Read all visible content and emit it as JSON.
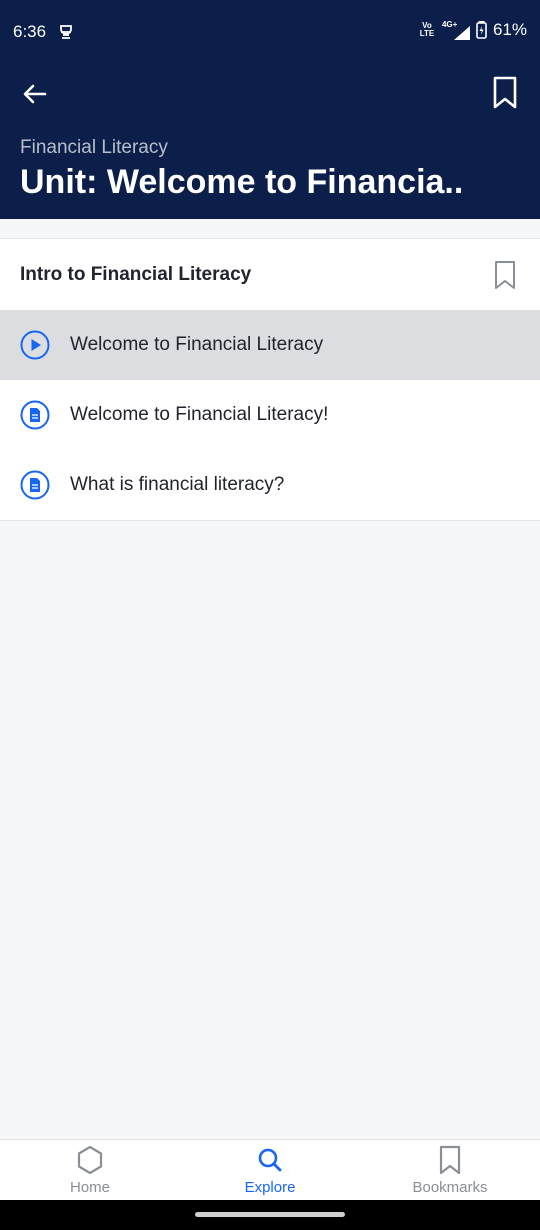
{
  "status_bar": {
    "time": "6:36",
    "volte_top": "Vo",
    "volte_bottom": "LTE",
    "network": "4G+",
    "battery": "61%"
  },
  "header": {
    "subject": "Financial Literacy",
    "unit_title": "Unit: Welcome to Financia.."
  },
  "lesson": {
    "title": "Intro to Financial Literacy",
    "items": [
      {
        "label": "Welcome to Financial Literacy",
        "icon": "play-circle-icon",
        "active": true
      },
      {
        "label": "Welcome to Financial Literacy!",
        "icon": "article-icon",
        "active": false
      },
      {
        "label": "What is financial literacy?",
        "icon": "article-icon",
        "active": false
      }
    ]
  },
  "bottom_nav": {
    "tabs": [
      {
        "label": "Home",
        "icon": "hexagon-home-icon",
        "selected": false
      },
      {
        "label": "Explore",
        "icon": "search-icon",
        "selected": true
      },
      {
        "label": "Bookmarks",
        "icon": "bookmark-icon",
        "selected": false
      }
    ]
  },
  "colors": {
    "header_bg": "#0c1f4a",
    "accent": "#1865f2",
    "active_row": "#dcdde0",
    "page_bg": "#f6f7f9"
  }
}
